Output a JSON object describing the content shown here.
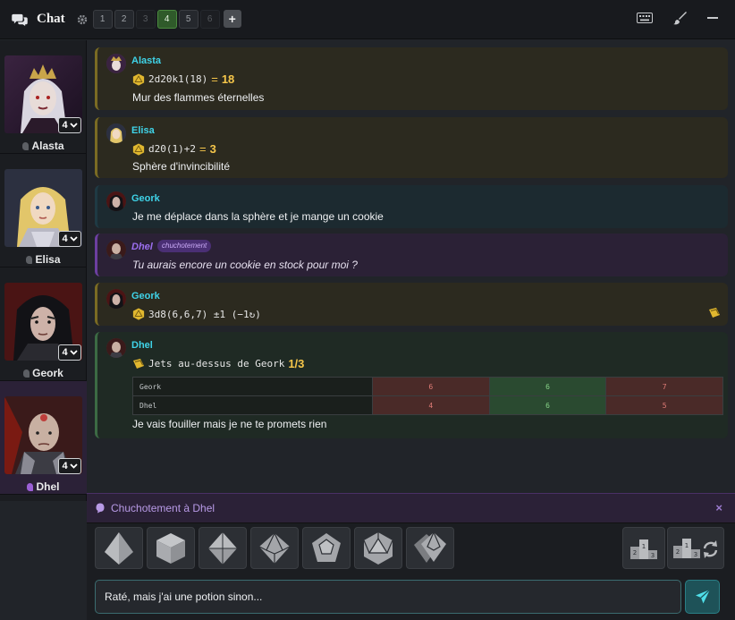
{
  "header": {
    "title": "Chat",
    "tabs": [
      "1",
      "2",
      "3",
      "4",
      "5",
      "6"
    ],
    "active_tab": "4",
    "add_label": "+"
  },
  "players": [
    {
      "name": "Alasta",
      "level": "4",
      "selected": false
    },
    {
      "name": "Elisa",
      "level": "4",
      "selected": false
    },
    {
      "name": "Geork",
      "level": "4",
      "selected": false
    },
    {
      "name": "Dhel",
      "level": "4",
      "selected": true
    }
  ],
  "messages": [
    {
      "author": "Alasta",
      "formula": "2d20k1(18)",
      "eq": "=",
      "result": "18",
      "text": "Mur des flammes éternelles"
    },
    {
      "author": "Elisa",
      "formula": "d20(1)+2",
      "eq": "=",
      "result": "3",
      "text": "Sphère d'invincibilité"
    },
    {
      "author": "Geork",
      "text": "Je me déplace dans la sphère et je mange un cookie"
    },
    {
      "author": "Dhel",
      "tag": "chuchotement",
      "text": "Tu aurais encore un cookie en stock pour moi ?"
    },
    {
      "author": "Geork",
      "formula": "3d8(6,6,7) ±1 (−1↻)"
    },
    {
      "author": "Dhel",
      "roll_title": "Jets au-dessus de Geork",
      "roll_score": "1/3",
      "text": "Je vais fouiller mais je ne te promets rien",
      "table": [
        {
          "name": "Geork",
          "values": [
            "6",
            "6",
            "7"
          ],
          "status": [
            "bad",
            "good",
            "bad"
          ]
        },
        {
          "name": "Dhel",
          "values": [
            "4",
            "6",
            "5"
          ],
          "status": [
            "bad",
            "good",
            "bad"
          ]
        }
      ]
    }
  ],
  "whisper": {
    "label": "Chuchotement à Dhel",
    "close": "×"
  },
  "dice": [
    "d4",
    "d6",
    "d8",
    "d10",
    "d12",
    "d20",
    "d100"
  ],
  "input": {
    "value": "Raté, mais j'ai une potion sinon..."
  },
  "colors": {
    "accent": "#3fd3e8",
    "whisper": "#9c6ff0",
    "gold": "#f6c64a",
    "success": "#86d287",
    "fail": "#e07c76"
  }
}
